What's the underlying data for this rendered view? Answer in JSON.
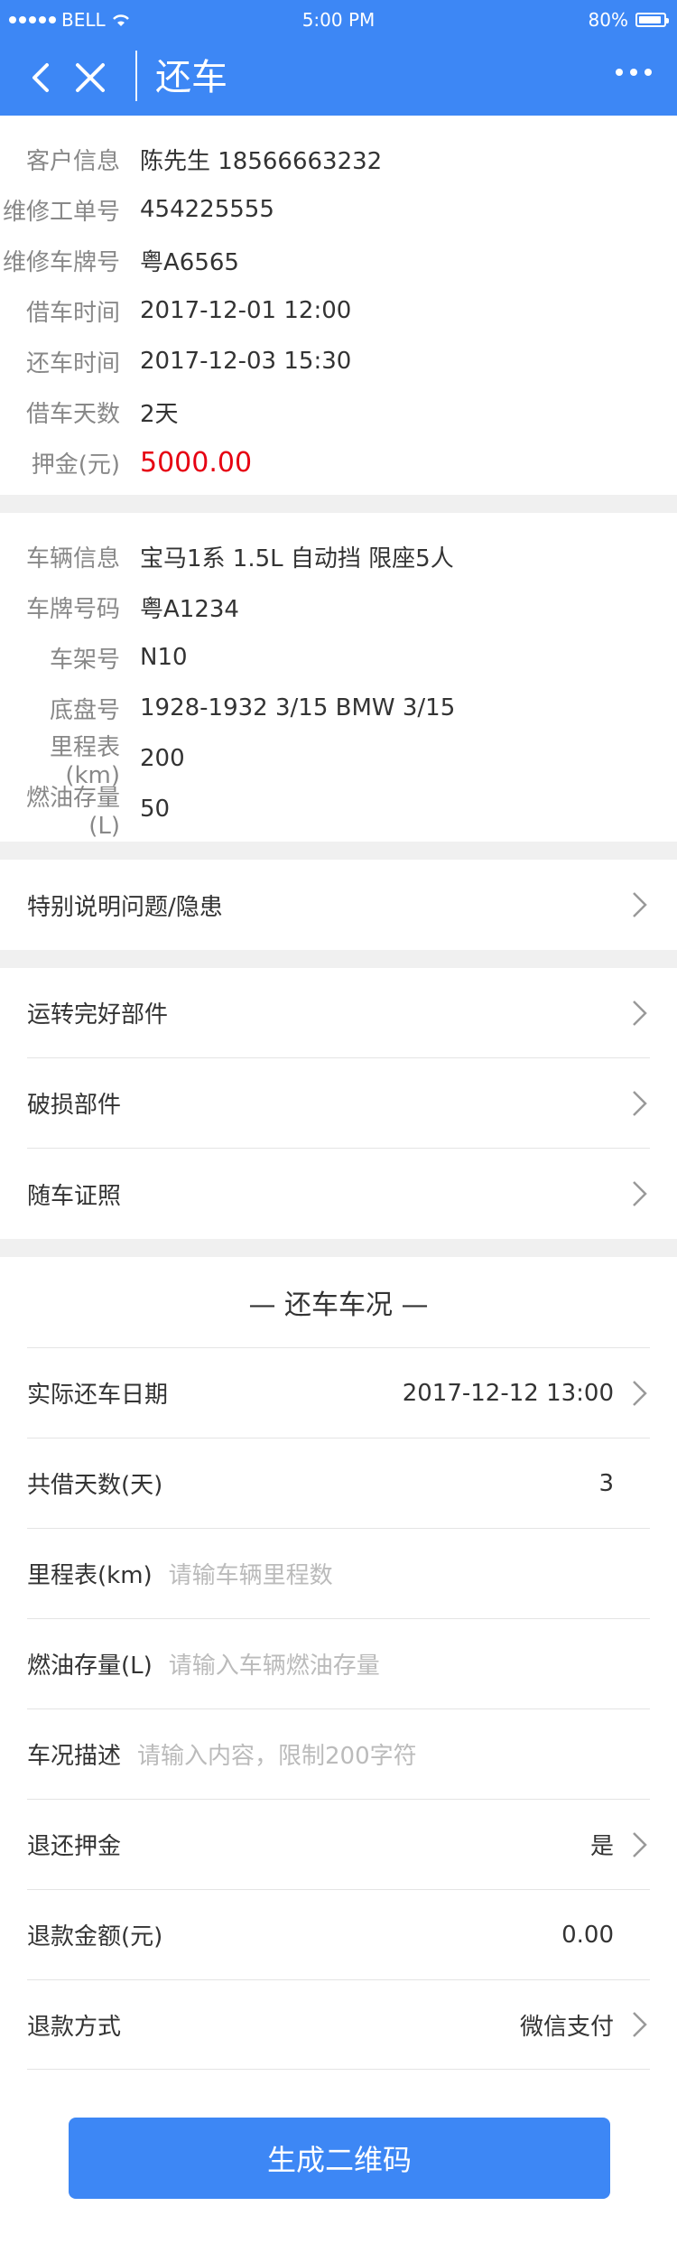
{
  "status_bar": {
    "carrier": "BELL",
    "time": "5:00 PM",
    "battery": "80%",
    "battery_level": 0.8
  },
  "header": {
    "title": "还车"
  },
  "loan_info": [
    {
      "label": "客户信息",
      "value": "陈先生  18566663232"
    },
    {
      "label": "维修工单号",
      "value": "454225555"
    },
    {
      "label": "维修车牌号",
      "value": "粤A6565"
    },
    {
      "label": "借车时间",
      "value": "2017-12-01 12:00"
    },
    {
      "label": "还车时间",
      "value": "2017-12-03 15:30"
    },
    {
      "label": "借车天数",
      "value": "2天"
    },
    {
      "label": "押金(元)",
      "value": "5000.00"
    }
  ],
  "vehicle_info": [
    {
      "label": "车辆信息",
      "value": "宝马1系  1.5L  自动挡  限座5人"
    },
    {
      "label": "车牌号码",
      "value": "粤A1234"
    },
    {
      "label": "车架号",
      "value": "N10"
    },
    {
      "label": "底盘号",
      "value": "1928-1932 3/15 BMW 3/15"
    },
    {
      "label": "里程表(km)",
      "value": "200"
    },
    {
      "label": "燃油存量(L)",
      "value": "50"
    }
  ],
  "special_note": {
    "label": "特别说明问题/隐患"
  },
  "parts": [
    {
      "label": "运转完好部件"
    },
    {
      "label": "破损部件"
    },
    {
      "label": "随车证照"
    }
  ],
  "return_condition": {
    "heading": "— 还车车况 —",
    "actual_date": {
      "label": "实际还车日期",
      "value": "2017-12-12  13:00"
    },
    "total_days": {
      "label": "共借天数(天)",
      "value": "3"
    },
    "mileage": {
      "label": "里程表(km)",
      "placeholder": "请输车辆里程数"
    },
    "fuel": {
      "label": "燃油存量(L)",
      "placeholder": "请输入车辆燃油存量"
    },
    "condition": {
      "label": "车况描述",
      "placeholder": "请输入内容，限制200字符"
    },
    "refund_deposit": {
      "label": "退还押金",
      "value": "是"
    },
    "refund_amount": {
      "label": "退款金额(元)",
      "value": "0.00"
    },
    "refund_method": {
      "label": "退款方式",
      "value": "微信支付"
    }
  },
  "submit": {
    "label": "生成二维码"
  },
  "colors": {
    "primary": "#3d87f5",
    "deposit_red": "#e60012",
    "background": "#f0f0f0"
  }
}
